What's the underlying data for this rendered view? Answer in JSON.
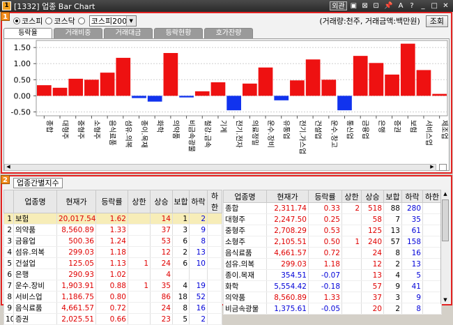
{
  "window": {
    "title": "[1332] 업종 Bar Chart",
    "controls": [
      "외관",
      "▣",
      "⊠",
      "⊡",
      "📌",
      "A",
      "?",
      "_",
      "□",
      "✕"
    ]
  },
  "panel1": {
    "badge": "1",
    "radios": [
      {
        "label": "코스피",
        "checked": true
      },
      {
        "label": "코스닥",
        "checked": false
      },
      {
        "label": "",
        "checked": false
      }
    ],
    "select": {
      "value": "코스피200"
    },
    "unit": "(거래량:천주, 거래금액:백만원)",
    "query_button": "조회",
    "tabs": [
      "등락율",
      "거래비중",
      "거래대금",
      "등락현황",
      "호가잔량"
    ],
    "active_tab": 0
  },
  "chart_data": {
    "type": "bar",
    "categories": [
      "종합",
      "대형주",
      "중형주",
      "소형주",
      "음식료품",
      "섬유.의복",
      "종이.목재",
      "화학",
      "의약품",
      "비금속광물",
      "철강.금속",
      "기계",
      "전기.전자",
      "의료정밀",
      "운수.장비",
      "유통업",
      "전기.가스업",
      "건설업",
      "운수.창고",
      "통신업",
      "금융업",
      "은행",
      "증권",
      "보험",
      "서비스업",
      "제조업"
    ],
    "values": [
      0.33,
      0.25,
      0.53,
      0.5,
      0.72,
      1.18,
      -0.07,
      -0.18,
      1.33,
      -0.05,
      0.14,
      0.42,
      -0.45,
      0.38,
      0.88,
      -0.14,
      0.48,
      1.13,
      0.5,
      -0.45,
      1.24,
      1.02,
      0.66,
      1.62,
      0.8,
      0.06
    ],
    "yticks": [
      "1.50",
      "1.00",
      "0.50",
      "0.00",
      "-0.50"
    ],
    "ylim": [
      -0.62,
      1.72
    ],
    "colors": {
      "positive": "#ee1111",
      "negative": "#1133ee"
    }
  },
  "panel2": {
    "badge": "2",
    "tab_label": "업종간별지수",
    "columns": [
      "",
      "업종명",
      "현재가",
      "등락률",
      "상한",
      "상승",
      "보합",
      "하락",
      "하한"
    ],
    "left_rows": [
      [
        "1",
        "보험",
        "20,017.54",
        "1.62",
        "",
        "14",
        "1",
        "2",
        ""
      ],
      [
        "2",
        "의약품",
        "8,560.89",
        "1.33",
        "",
        "37",
        "3",
        "9",
        ""
      ],
      [
        "3",
        "금융업",
        "500.36",
        "1.24",
        "",
        "53",
        "6",
        "8",
        ""
      ],
      [
        "4",
        "섬유.의복",
        "299.03",
        "1.18",
        "",
        "12",
        "2",
        "13",
        ""
      ],
      [
        "5",
        "건설업",
        "125.05",
        "1.13",
        "1",
        "24",
        "6",
        "10",
        ""
      ],
      [
        "6",
        "은행",
        "290.93",
        "1.02",
        "",
        "4",
        "",
        "",
        ""
      ],
      [
        "7",
        "운수.장비",
        "1,903.91",
        "0.88",
        "1",
        "35",
        "4",
        "19",
        ""
      ],
      [
        "8",
        "서비스업",
        "1,186.75",
        "0.80",
        "",
        "86",
        "18",
        "52",
        ""
      ],
      [
        "9",
        "음식료품",
        "4,661.57",
        "0.72",
        "",
        "24",
        "8",
        "16",
        ""
      ],
      [
        "10",
        "증권",
        "2,025.51",
        "0.66",
        "",
        "23",
        "5",
        "2",
        ""
      ]
    ],
    "right_rows": [
      [
        "종합",
        "2,311.74",
        "0.33",
        "2",
        "518",
        "88",
        "280",
        ""
      ],
      [
        "대형주",
        "2,247.50",
        "0.25",
        "",
        "58",
        "7",
        "35",
        ""
      ],
      [
        "중형주",
        "2,708.29",
        "0.53",
        "",
        "125",
        "13",
        "61",
        ""
      ],
      [
        "소형주",
        "2,105.51",
        "0.50",
        "1",
        "240",
        "57",
        "158",
        ""
      ],
      [
        "음식료품",
        "4,661.57",
        "0.72",
        "",
        "24",
        "8",
        "16",
        ""
      ],
      [
        "섬유.의복",
        "299.03",
        "1.18",
        "",
        "12",
        "2",
        "13",
        ""
      ],
      [
        "종이.목재",
        "354.51",
        "-0.07",
        "",
        "13",
        "4",
        "5",
        ""
      ],
      [
        "화학",
        "5,554.42",
        "-0.18",
        "",
        "57",
        "9",
        "41",
        ""
      ],
      [
        "의약품",
        "8,560.89",
        "1.33",
        "",
        "37",
        "3",
        "9",
        ""
      ],
      [
        "비금속광물",
        "1,375.61",
        "-0.05",
        "",
        "20",
        "2",
        "8",
        ""
      ]
    ]
  }
}
